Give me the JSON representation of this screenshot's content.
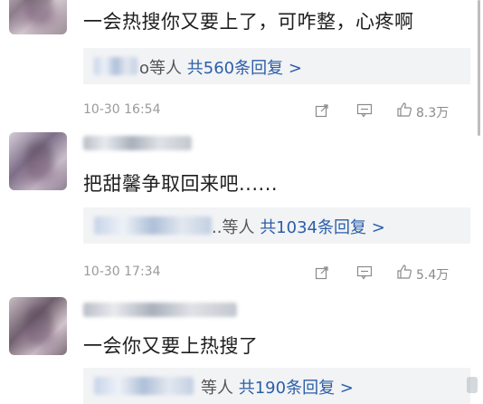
{
  "comments": [
    {
      "text": "一会热搜你又要上了，可咋整，心疼啊",
      "reply_etc": "o等人",
      "reply_count": "共560条回复 >",
      "time": "10-30 16:54",
      "likes": "8.3万"
    },
    {
      "text": "把甜馨争取回来吧......",
      "reply_etc": "..等人",
      "reply_count": "共1034条回复 >",
      "time": "10-30 17:34",
      "likes": "5.4万"
    },
    {
      "text": "一会你又要上热搜了",
      "reply_etc": "等人",
      "reply_count": "共190条回复 >"
    }
  ]
}
